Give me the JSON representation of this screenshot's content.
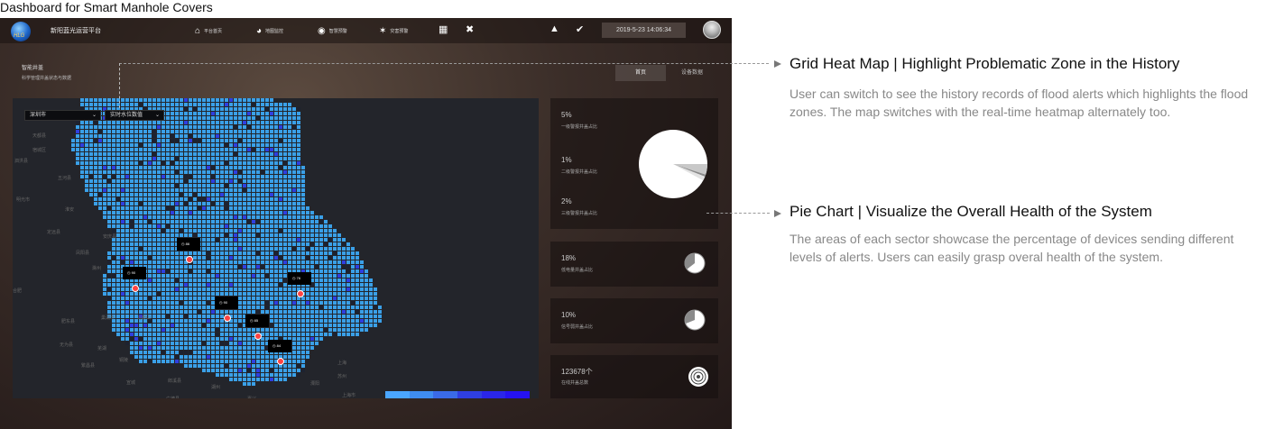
{
  "page_title": "Dashboard for Smart Manhole Covers",
  "header": {
    "logo_text": "HLG",
    "app_name": "新阳蓝光运营平台",
    "nav": [
      {
        "icon": "home-icon",
        "label": "平台首页"
      },
      {
        "icon": "globe-icon",
        "label": "地图监控"
      },
      {
        "icon": "bulb-icon",
        "label": "智慧预警"
      },
      {
        "icon": "alarm-icon",
        "label": "灾害预警"
      }
    ],
    "datetime": "2019-5-23 14:06:34"
  },
  "section": {
    "title": "智能井盖",
    "subtitle": "科学管理井盖状态与数据"
  },
  "tabs": [
    {
      "label": "首页",
      "active": true
    },
    {
      "label": "设备数据",
      "active": false
    }
  ],
  "map": {
    "city_select": "深圳市",
    "metric_select": "实时水位数值",
    "places": [
      "天都县",
      "宿城区",
      "泗洪县",
      "五河县",
      "明光市",
      "淮安",
      "凤阳县",
      "定远县",
      "安庆县",
      "滁州",
      "合肥",
      "肥东县",
      "巢湖市",
      "马鞍山",
      "无为县",
      "芜湖",
      "繁昌县",
      "铜陵",
      "宣城",
      "郎溪县",
      "广德县",
      "湖州",
      "嘉兴",
      "上海",
      "苏州",
      "溧阳",
      "上海市"
    ],
    "markers": [
      {
        "value": "86"
      },
      {
        "value": "90"
      },
      {
        "value": "76"
      },
      {
        "value": "90"
      },
      {
        "value": "85"
      },
      {
        "value": "84"
      }
    ],
    "legend_ticks": [
      "0",
      "20",
      "40",
      "60",
      "80",
      "100"
    ],
    "legend_colors": [
      "#4aa6ff",
      "#3f8cf0",
      "#3a6ae6",
      "#2f3fe0",
      "#2a26e8",
      "#2512f0"
    ],
    "cell_color": "#3aa0e8",
    "hot_color": "#2f3fe0"
  },
  "stats": {
    "alerts": [
      {
        "pct": "5%",
        "label": "一级警报井盖占比"
      },
      {
        "pct": "1%",
        "label": "二级警报井盖占比"
      },
      {
        "pct": "2%",
        "label": "三级警报井盖占比"
      }
    ],
    "low_power": {
      "pct": "18%",
      "label": "低电量井盖占比"
    },
    "weak_signal": {
      "pct": "10%",
      "label": "信号弱井盖占比"
    },
    "online": {
      "count": "123678个",
      "label": "在线井盖总数"
    }
  },
  "chart_data": {
    "type": "pie",
    "categories": [
      "一级警报井盖占比",
      "二级警报井盖占比",
      "三级警报井盖占比"
    ],
    "values": [
      5,
      1,
      2
    ],
    "unit": "%"
  },
  "annotations": [
    {
      "title": "Grid Heat Map | Highlight Problematic Zone in the History",
      "desc": "User can switch to see the history records of flood alerts which highlights the flood zones. The map switches with the real-time heatmap  alternately too."
    },
    {
      "title": "Pie Chart | Visualize the Overall Health of the System",
      "desc": "The areas of each sector showcase the percentage of devices sending different levels of alerts. Users can easily grasp overal health of the system."
    }
  ]
}
